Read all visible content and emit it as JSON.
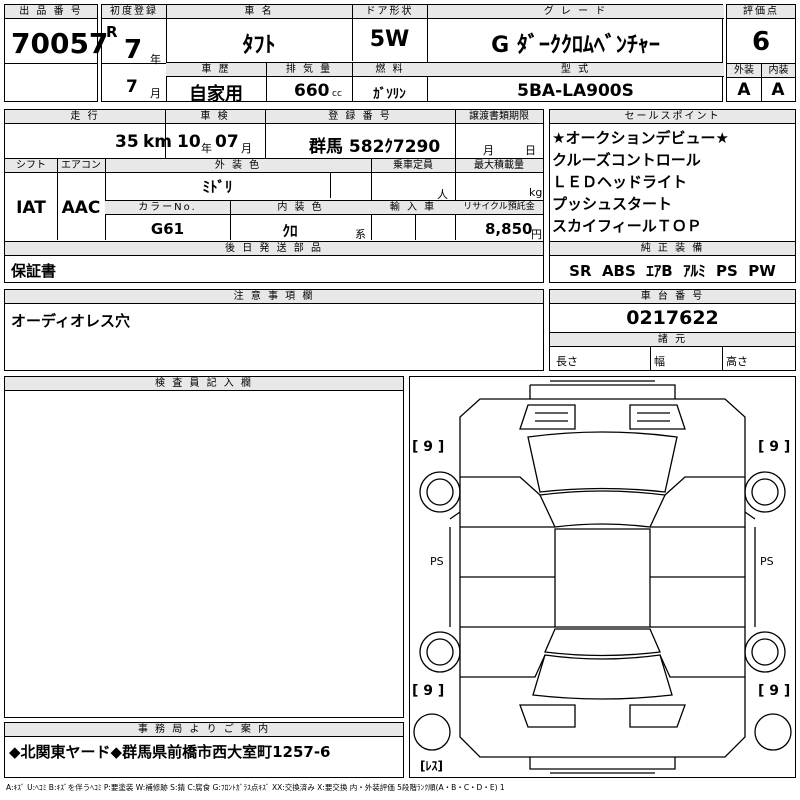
{
  "sheet": {
    "lot_no_label": "出 品 番 号",
    "lot_no": "70057",
    "first_reg_label": "初度登録",
    "era": "R",
    "first_reg_year": "7",
    "year_unit": "年",
    "first_reg_month": "7",
    "month_unit": "月",
    "car_name_label": "車 名",
    "car_name": "ﾀﾌﾄ",
    "door_label": "ドア形状",
    "door": "5W",
    "grade_label": "グ レ ー ド",
    "grade": "G ﾀﾞｰｸｸﾛﾑﾍﾞﾝﾁｬｰ",
    "score_label": "評価点",
    "score": "6",
    "history_label": "車 歴",
    "history": "自家用",
    "displacement_label": "排 気 量",
    "displacement": "660",
    "cc_unit": "cc",
    "fuel_label": "燃 料",
    "fuel": "ｶﾞｿﾘﾝ",
    "model_label": "型 式",
    "model": "5BA-LA900S",
    "exterior_label": "外装",
    "exterior": "A",
    "interior_label": "内装",
    "interior": "A",
    "mileage_label": "走 行",
    "mileage": "35",
    "km_unit": "km",
    "inspection_label": "車 検",
    "inspection_year": "10",
    "inspection_month": "07",
    "reg_no_label": "登 録 番 号",
    "reg_no": "群馬 582ｸ7290",
    "transfer_label": "譲渡書類期限",
    "transfer_month_unit": "月",
    "transfer_day_unit": "日",
    "shift_label": "シフト",
    "shift": "IAT",
    "ac_label": "エアコン",
    "ac": "AAC",
    "ext_color_label": "外 装 色",
    "ext_color": "ﾐﾄﾞﾘ",
    "capacity_label": "乗車定員",
    "capacity_unit": "人",
    "max_load_label": "最大積載量",
    "max_load_unit": "kg",
    "color_no_label": "カラーNo.",
    "color_no": "G61",
    "int_color_label": "内 装 色",
    "int_color": "ｸﾛ",
    "int_color_unit": "系",
    "import_label": "輸 入 車",
    "recycle_label": "リサイクル預託金",
    "recycle": "8,850",
    "yen_unit": "円",
    "sales_points_label": "セールスポイント",
    "sales_points": [
      "★オークションデビュー★",
      "クルーズコントロール",
      "ＬＥＤヘッドライト",
      "プッシュスタート",
      "スカイフィールＴＯＰ"
    ],
    "later_parts_label": "後 日 発 送 部 品",
    "later_parts": "保証書",
    "equipment_label": "純 正 装 備",
    "equipment": "SR  ABS  ｴｱB  ｱﾙﾐ  PS  PW",
    "notes_label": "注 意 事 項 欄",
    "notes": "オーディオレス穴",
    "chassis_label": "車 台 番 号",
    "chassis": "0217622",
    "dims_label": "諸 元",
    "length_label": "長さ",
    "width_label": "幅",
    "height_label": "高さ",
    "inspector_label": "検 査 員 記 入 欄",
    "office_label": "事 務 局 よ り ご 案 内",
    "office": "◆北関東ヤード◆群馬県前橋市西大室町1257-6",
    "tire_fl": "[ 9 ]",
    "tire_fr": "[ 9 ]",
    "tire_rl": "[ 9 ]",
    "tire_rr": "[ 9 ]",
    "spare": "[ﾚｽ]",
    "ps_left": "PS",
    "ps_right": "PS",
    "legend": "A:ｷｽﾞ U:ﾍｺﾐ B:ｷｽﾞを伴うﾍｺﾐ P:要塗装 W:補修跡 S:錆 C:腐食 G:ﾌﾛﾝﾄｶﾞﾗｽ点ｷｽﾞ XX:交換済み X:要交換  内・外装評価 5段階ﾗﾝｸ順(A・B・C・D・E) 1"
  }
}
